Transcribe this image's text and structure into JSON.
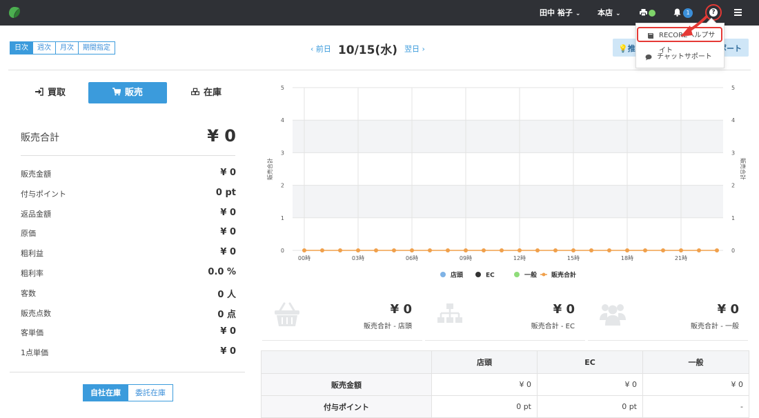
{
  "topbar": {
    "user": "田中 裕子",
    "store": "本店",
    "notification_count": "1"
  },
  "period_tabs": [
    "日次",
    "週次",
    "月次",
    "期間指定"
  ],
  "date_nav": {
    "prev": "‹ 前日",
    "date": "10/15(水)",
    "next": "翌日 ›"
  },
  "report_button": {
    "left_text": "推",
    "right_text": "ポート"
  },
  "help_menu": {
    "items": [
      "RECOREヘルプサイト",
      "チャットサポート"
    ]
  },
  "mode_tabs": [
    "買取",
    "販売",
    "在庫"
  ],
  "summary": {
    "total_label": "販売合計",
    "total_value": "¥ 0",
    "metrics": [
      {
        "label": "販売金額",
        "value": "¥ 0"
      },
      {
        "label": "付与ポイント",
        "value": "0 pt"
      },
      {
        "label": "返品金額",
        "value": "¥ 0"
      },
      {
        "label": "原価",
        "value": "¥ 0"
      },
      {
        "label": "粗利益",
        "value": "¥ 0"
      },
      {
        "label": "粗利率",
        "value": "0.0 %"
      },
      {
        "label": "客数",
        "value": "0 人"
      },
      {
        "label": "販売点数",
        "value": "0 点"
      },
      {
        "label": "客単価",
        "value": "¥ 0"
      },
      {
        "label": "1点単価",
        "value": "¥ 0"
      }
    ]
  },
  "stock_tabs": [
    "自社在庫",
    "委託在庫"
  ],
  "chart_data": {
    "type": "line",
    "ylabel": "販売合計",
    "ylabel_right": "販売合計",
    "ylim": [
      0,
      5
    ],
    "yticks": [
      "0",
      "1",
      "2",
      "3",
      "4",
      "5"
    ],
    "xticks": [
      "00時",
      "03時",
      "06時",
      "09時",
      "12時",
      "15時",
      "18時",
      "21時"
    ],
    "x": [
      0,
      1,
      2,
      3,
      4,
      5,
      6,
      7,
      8,
      9,
      10,
      11,
      12,
      13,
      14,
      15,
      16,
      17,
      18,
      19,
      20,
      21,
      22,
      23
    ],
    "series": [
      {
        "name": "店頭",
        "color": "#7fb3e6",
        "values": []
      },
      {
        "name": "EC",
        "color": "#333333",
        "values": []
      },
      {
        "name": "一般",
        "color": "#8fdc7a",
        "values": []
      },
      {
        "name": "販売合計",
        "color": "#f0a04b",
        "values": [
          0,
          0,
          0,
          0,
          0,
          0,
          0,
          0,
          0,
          0,
          0,
          0,
          0,
          0,
          0,
          0,
          0,
          0,
          0,
          0,
          0,
          0,
          0,
          0
        ]
      }
    ],
    "legend": "bottom",
    "grid": true
  },
  "cards": [
    {
      "value": "¥ 0",
      "label": "販売合計 - 店頭",
      "icon": "basket-icon"
    },
    {
      "value": "¥ 0",
      "label": "販売合計 - EC",
      "icon": "sitemap-icon"
    },
    {
      "value": "¥ 0",
      "label": "販売合計 - 一般",
      "icon": "users-icon"
    }
  ],
  "table": {
    "headers": [
      "",
      "店頭",
      "EC",
      "一般"
    ],
    "rows": [
      {
        "label": "販売金額",
        "cells": [
          "¥ 0",
          "¥ 0",
          "¥ 0"
        ]
      },
      {
        "label": "付与ポイント",
        "cells": [
          "0 pt",
          "0 pt",
          "-"
        ]
      }
    ]
  }
}
